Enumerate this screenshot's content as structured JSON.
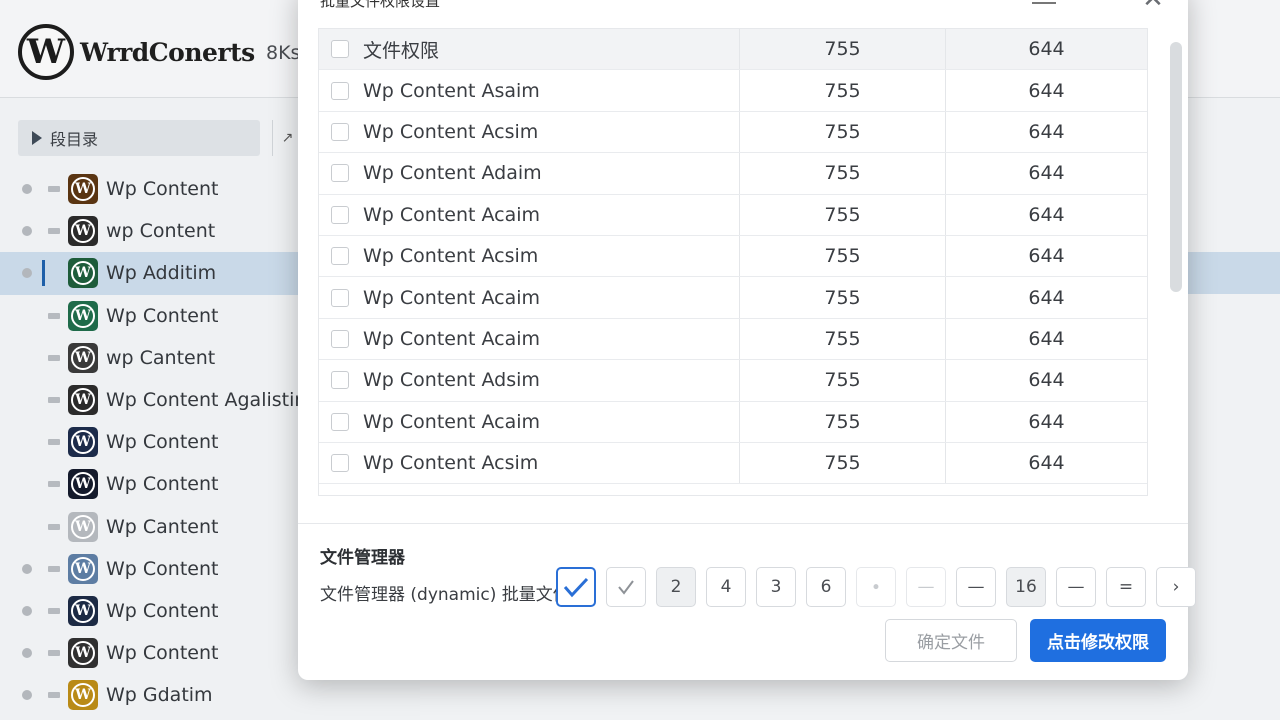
{
  "app": {
    "brand_name": "WrrdConerts",
    "brand_logo_letter": "W",
    "brand_meta": "8Ks"
  },
  "sidebar": {
    "dir_button": "段目录",
    "tool_glyph": "↗",
    "items": [
      {
        "label": "Wp Content",
        "icon_color": "#5a3512",
        "dot": true,
        "selected": false
      },
      {
        "label": "wp Content",
        "icon_color": "#2a2a2a",
        "dot": true,
        "selected": false
      },
      {
        "label": "Wp Additim",
        "icon_color": "#1d5c3a",
        "dot": true,
        "selected": true
      },
      {
        "label": "Wp Content",
        "icon_color": "#1f6b4a",
        "dot": false,
        "selected": false
      },
      {
        "label": "wp Cantent",
        "icon_color": "#3a3a3a",
        "dot": false,
        "selected": false
      },
      {
        "label": "Wp Content Agalistin",
        "icon_color": "#2b2b2b",
        "dot": false,
        "selected": false
      },
      {
        "label": "Wp Content",
        "icon_color": "#1c2b4a",
        "dot": false,
        "selected": false
      },
      {
        "label": "Wp Content",
        "icon_color": "#141a2b",
        "dot": false,
        "selected": false
      },
      {
        "label": "Wp Cantent",
        "icon_color": "#b4b8bd",
        "dot": false,
        "selected": false
      },
      {
        "label": "Wp Content",
        "icon_color": "#5d7da3",
        "dot": true,
        "selected": false
      },
      {
        "label": "Wp Content",
        "icon_color": "#1c2a44",
        "dot": true,
        "selected": false
      },
      {
        "label": "Wp Content",
        "icon_color": "#303030",
        "dot": true,
        "selected": false
      },
      {
        "label": "Wp Gdatim",
        "icon_color": "#b98a16",
        "dot": true,
        "selected": false
      }
    ]
  },
  "modal": {
    "title": "批量文件权限设置",
    "close_glyph": "✕",
    "expand_glyph": "↗",
    "table": {
      "header": {
        "name": "文件权限",
        "c1": "755",
        "c2": "644"
      },
      "rows": [
        {
          "name": "Wp Content Asaim",
          "c1": "755",
          "c2": "644"
        },
        {
          "name": "Wp Content Acsim",
          "c1": "755",
          "c2": "644"
        },
        {
          "name": "Wp Content Adaim",
          "c1": "755",
          "c2": "644"
        },
        {
          "name": "Wp Content Acaim",
          "c1": "755",
          "c2": "644"
        },
        {
          "name": "Wp Content Acsim",
          "c1": "755",
          "c2": "644"
        },
        {
          "name": "Wp Content Acaim",
          "c1": "755",
          "c2": "644"
        },
        {
          "name": "Wp Content Acaim",
          "c1": "755",
          "c2": "644"
        },
        {
          "name": "Wp Content Adsim",
          "c1": "755",
          "c2": "644"
        },
        {
          "name": "Wp Content Acaim",
          "c1": "755",
          "c2": "644"
        },
        {
          "name": "Wp Content Acsim",
          "c1": "755",
          "c2": "644"
        }
      ]
    },
    "file_manager": {
      "title": "文件管理器",
      "label": "文件管理器 (dynamic) 批量文件 :"
    },
    "pager": {
      "pages": [
        "2",
        "4",
        "3",
        "6",
        "16"
      ],
      "dash": "—",
      "dot": "∙",
      "equals": "=",
      "next": "›"
    },
    "buttons": {
      "secondary": "确定文件",
      "primary": "点击修改权限"
    }
  },
  "colors": {
    "accent": "#1f6fe0",
    "selected_row": "#c9d9e8"
  }
}
